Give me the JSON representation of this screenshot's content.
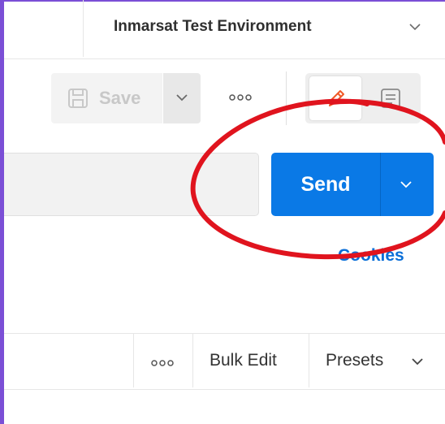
{
  "environment": {
    "name": "Inmarsat Test Environment",
    "chevron_icon": "chevron-down-icon"
  },
  "toolbar": {
    "save_label": "Save",
    "save_icon": "save-icon",
    "more_icon": "more-horizontal-icon",
    "view_toggle": {
      "active": "edit-icon",
      "inactive": "document-icon"
    }
  },
  "request": {
    "send_label": "Send",
    "send_dropdown_icon": "chevron-down-icon",
    "cookies_label": "Cookies"
  },
  "params_toolbar": {
    "more_icon": "more-horizontal-icon",
    "bulk_edit_label": "Bulk Edit",
    "presets_label": "Presets"
  },
  "colors": {
    "accent": "#0a79e6",
    "link": "#0b6fd8",
    "annotation": "#e0141e",
    "edit_icon": "#f05a28",
    "frame": "#7b4fd6"
  }
}
